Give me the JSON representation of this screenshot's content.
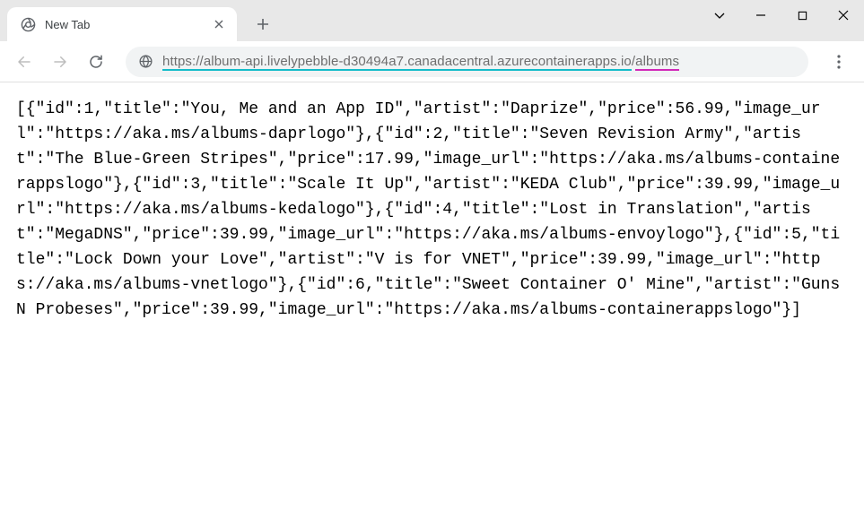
{
  "tab": {
    "title": "New Tab"
  },
  "url": {
    "protocol_host": "https://album-api.livelypebble-d30494a7.canadacentral.azurecontainerapps.io",
    "slash": "/",
    "path": "albums"
  },
  "response": {
    "raw": "[{\"id\":1,\"title\":\"You, Me and an App ID\",\"artist\":\"Daprize\",\"price\":56.99,\"image_url\":\"https://aka.ms/albums-daprlogo\"},{\"id\":2,\"title\":\"Seven Revision Army\",\"artist\":\"The Blue-Green Stripes\",\"price\":17.99,\"image_url\":\"https://aka.ms/albums-containerappslogo\"},{\"id\":3,\"title\":\"Scale It Up\",\"artist\":\"KEDA Club\",\"price\":39.99,\"image_url\":\"https://aka.ms/albums-kedalogo\"},{\"id\":4,\"title\":\"Lost in Translation\",\"artist\":\"MegaDNS\",\"price\":39.99,\"image_url\":\"https://aka.ms/albums-envoylogo\"},{\"id\":5,\"title\":\"Lock Down your Love\",\"artist\":\"V is for VNET\",\"price\":39.99,\"image_url\":\"https://aka.ms/albums-vnetlogo\"},{\"id\":6,\"title\":\"Sweet Container O' Mine\",\"artist\":\"Guns N Probeses\",\"price\":39.99,\"image_url\":\"https://aka.ms/albums-containerappslogo\"}]",
    "albums": [
      {
        "id": 1,
        "title": "You, Me and an App ID",
        "artist": "Daprize",
        "price": 56.99,
        "image_url": "https://aka.ms/albums-daprlogo"
      },
      {
        "id": 2,
        "title": "Seven Revision Army",
        "artist": "The Blue-Green Stripes",
        "price": 17.99,
        "image_url": "https://aka.ms/albums-containerappslogo"
      },
      {
        "id": 3,
        "title": "Scale It Up",
        "artist": "KEDA Club",
        "price": 39.99,
        "image_url": "https://aka.ms/albums-kedalogo"
      },
      {
        "id": 4,
        "title": "Lost in Translation",
        "artist": "MegaDNS",
        "price": 39.99,
        "image_url": "https://aka.ms/albums-envoylogo"
      },
      {
        "id": 5,
        "title": "Lock Down your Love",
        "artist": "V is for VNET",
        "price": 39.99,
        "image_url": "https://aka.ms/albums-vnetlogo"
      },
      {
        "id": 6,
        "title": "Sweet Container O' Mine",
        "artist": "Guns N Probeses",
        "price": 39.99,
        "image_url": "https://aka.ms/albums-containerappslogo"
      }
    ]
  }
}
